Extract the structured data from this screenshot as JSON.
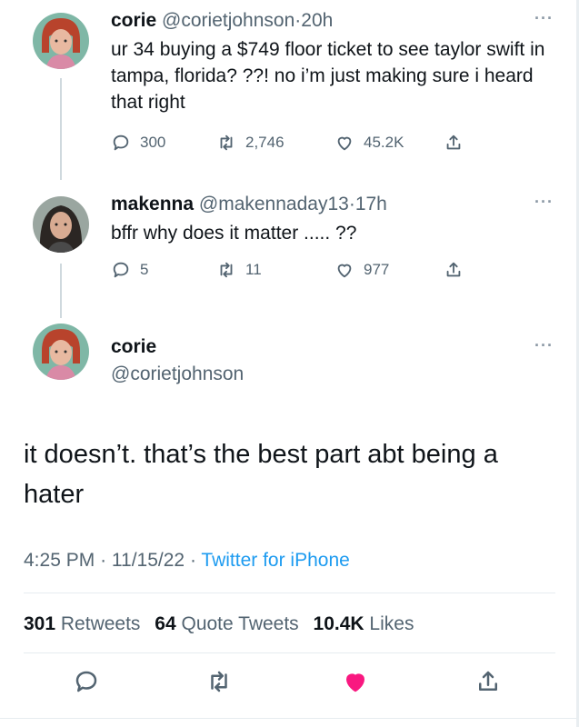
{
  "thread": [
    {
      "name": "corie",
      "handle": "@corietjohnson",
      "separator": "·",
      "time": "20h",
      "text": "ur 34 buying a $749 floor ticket to see taylor swift in tampa, florida? ??! no i’m just making sure i heard that right",
      "replies": "300",
      "retweets": "2,746",
      "likes": "45.2K"
    },
    {
      "name": "makenna",
      "handle": "@makennaday13",
      "separator": "·",
      "time": "17h",
      "text": "bffr why does it matter ..... ??",
      "replies": "5",
      "retweets": "11",
      "likes": "977"
    }
  ],
  "main_tweet": {
    "name": "corie",
    "handle": "@corietjohnson",
    "text": "it doesn’t. that’s the best part abt being a hater",
    "time": "4:25 PM",
    "separator": "·",
    "date": "11/15/22",
    "separator2": "·",
    "source": "Twitter for iPhone",
    "retweets_count": "301",
    "retweets_label": "Retweets",
    "quotes_count": "64",
    "quotes_label": "Quote Tweets",
    "likes_count": "10.4K",
    "likes_label": "Likes",
    "liked": true
  },
  "more_symbol": "···",
  "colors": {
    "text": "#0f1419",
    "secondary": "#536471",
    "link": "#1d9bf0",
    "like": "#f91880",
    "thread_line": "#cfd9de"
  },
  "icons": [
    "reply-icon",
    "retweet-icon",
    "like-icon",
    "share-icon",
    "more-icon"
  ]
}
